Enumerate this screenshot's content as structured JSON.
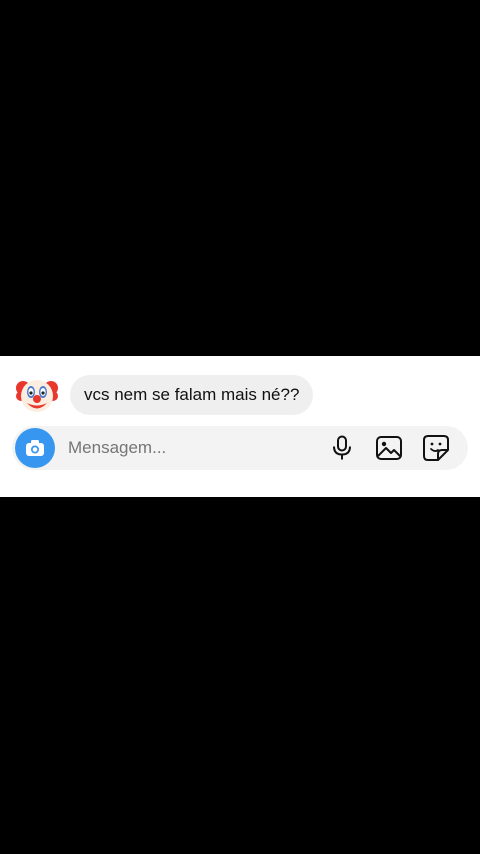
{
  "message": {
    "text": "vcs nem se falam mais né??",
    "avatar_icon": "clown-face-icon"
  },
  "composer": {
    "placeholder": "Mensagem...",
    "camera_icon": "camera-icon",
    "icons": [
      "microphone-icon",
      "gallery-icon",
      "sticker-icon"
    ]
  },
  "colors": {
    "accent": "#3797f0",
    "panel": "#ffffff",
    "bubble": "#efefef",
    "letterbox": "#000000"
  }
}
